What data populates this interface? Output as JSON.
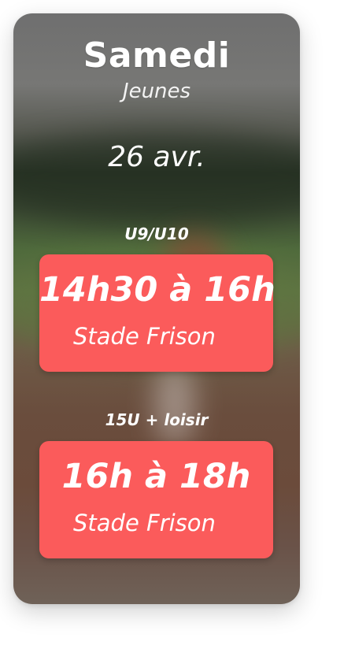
{
  "event": {
    "day": "Samedi",
    "category": "Jeunes",
    "date": "26 avr."
  },
  "sessions": [
    {
      "group": "U9/U10",
      "time": "14h30 à 16h",
      "venue": "Stade Frison"
    },
    {
      "group": "15U + loisir",
      "time": "16h à 18h",
      "venue": "Stade Frison"
    }
  ],
  "colors": {
    "slot_background": "#fb5b5b",
    "text": "#ffffff"
  }
}
